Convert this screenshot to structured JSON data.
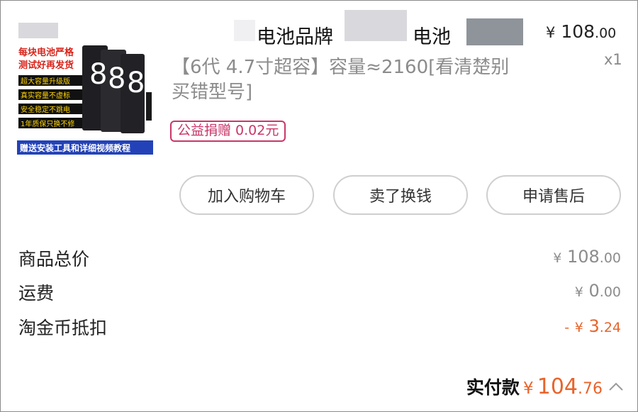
{
  "order_item": {
    "title_parts": [
      "电池品牌",
      "电池"
    ],
    "price": {
      "currency": "¥",
      "integer": "108",
      "decimal": ".00"
    },
    "quantity": "x1",
    "spec": "【6代 4.7寸超容】容量≈2160[看清楚别买错型号]",
    "charity_badge": "公益捐赠 0.02元",
    "thumbnail": {
      "headline": [
        "每块电池严格",
        "测试好再发货"
      ],
      "features": [
        "超大容量升级版",
        "真实容量不虚标",
        "安全稳定不跳电",
        "1年质保只换不修"
      ],
      "footer": "赠送安装工具和详细视频教程",
      "battery_number": "8"
    }
  },
  "actions": [
    "加入购物车",
    "卖了换钱",
    "申请售后"
  ],
  "summary": [
    {
      "label": "商品总价",
      "prefix": "",
      "currency": "¥",
      "integer": "108",
      "decimal": ".00",
      "color": "#8c8c8c"
    },
    {
      "label": "运费",
      "prefix": "",
      "currency": "¥",
      "integer": "0",
      "decimal": ".00",
      "color": "#8c8c8c"
    },
    {
      "label": "淘金币抵扣",
      "prefix": "-",
      "currency": "¥",
      "integer": "3",
      "decimal": ".24",
      "color": "#e8642b"
    }
  ],
  "total": {
    "label": "实付款",
    "currency": "¥",
    "integer": "104",
    "decimal": ".76"
  },
  "colors": {
    "accent": "#e8642b",
    "charity": "#c9366a",
    "muted": "#8c8c8c",
    "border": "#cfcfcf"
  }
}
